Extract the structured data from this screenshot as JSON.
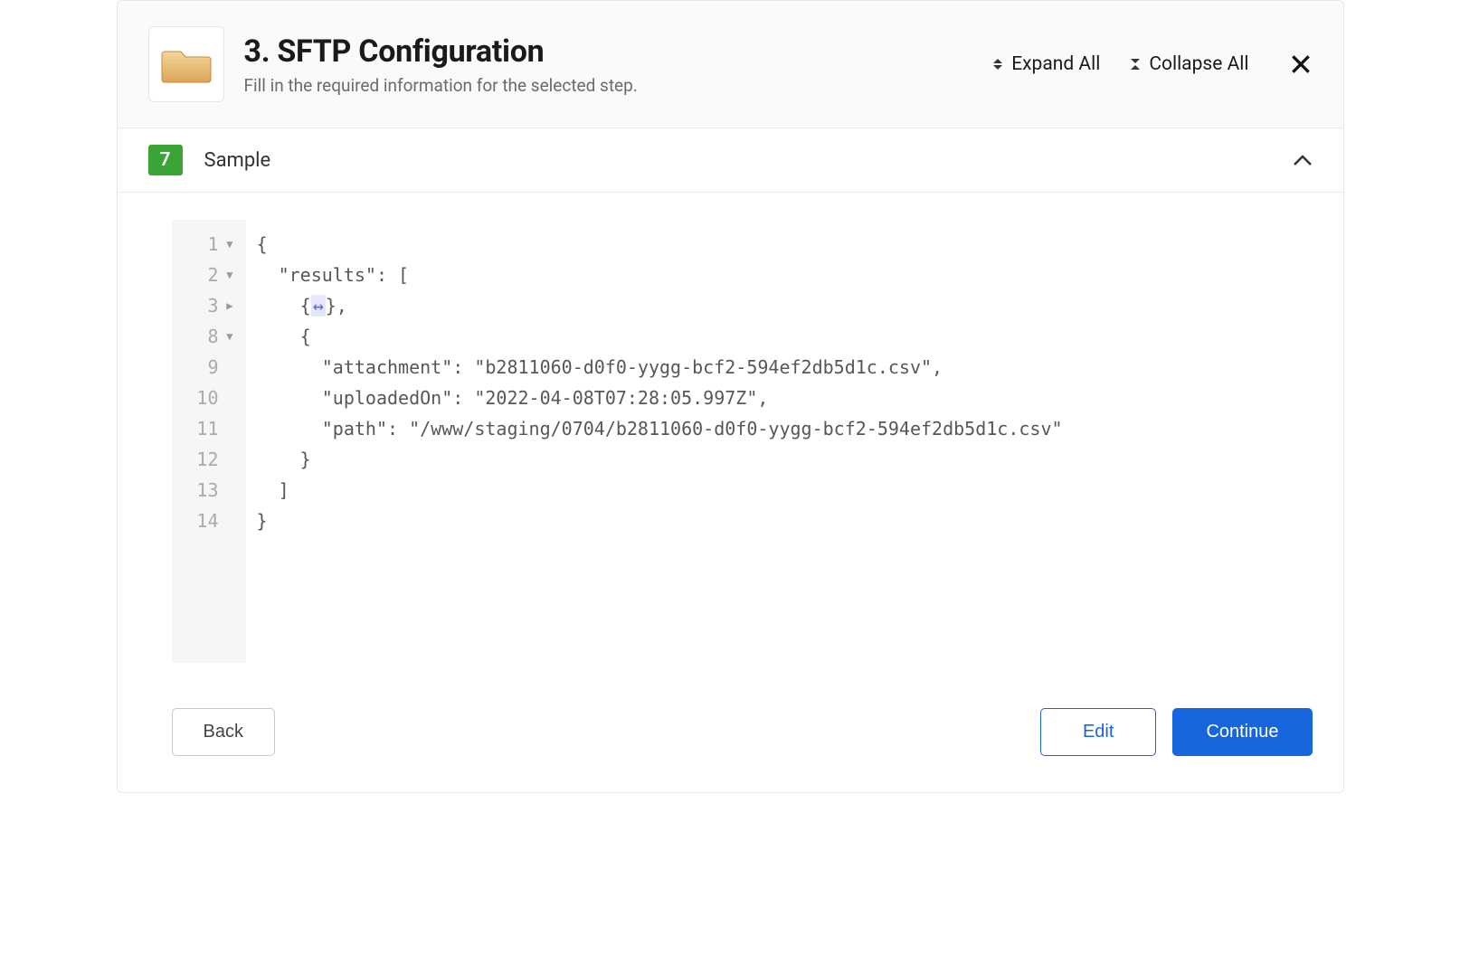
{
  "header": {
    "title": "3. SFTP Configuration",
    "subtitle": "Fill in the required information for the selected step.",
    "expand_label": "Expand All",
    "collapse_label": "Collapse All"
  },
  "section": {
    "badge": "7",
    "title": "Sample"
  },
  "code": {
    "lines": [
      {
        "num": "1",
        "fold": "open",
        "text": "{"
      },
      {
        "num": "2",
        "fold": "open",
        "text": "  \"results\": ["
      },
      {
        "num": "3",
        "fold": "collapsed",
        "text": "    {↔},"
      },
      {
        "num": "8",
        "fold": "open",
        "text": "    {"
      },
      {
        "num": "9",
        "fold": "",
        "text": "      \"attachment\": \"b2811060-d0f0-yygg-bcf2-594ef2db5d1c.csv\","
      },
      {
        "num": "10",
        "fold": "",
        "text": "      \"uploadedOn\": \"2022-04-08T07:28:05.997Z\","
      },
      {
        "num": "11",
        "fold": "",
        "text": "      \"path\": \"/www/staging/0704/b2811060-d0f0-yygg-bcf2-594ef2db5d1c.csv\""
      },
      {
        "num": "12",
        "fold": "",
        "text": "    }"
      },
      {
        "num": "13",
        "fold": "",
        "text": "  ]"
      },
      {
        "num": "14",
        "fold": "",
        "text": "}"
      }
    ]
  },
  "footer": {
    "back": "Back",
    "edit": "Edit",
    "continue": "Continue"
  }
}
